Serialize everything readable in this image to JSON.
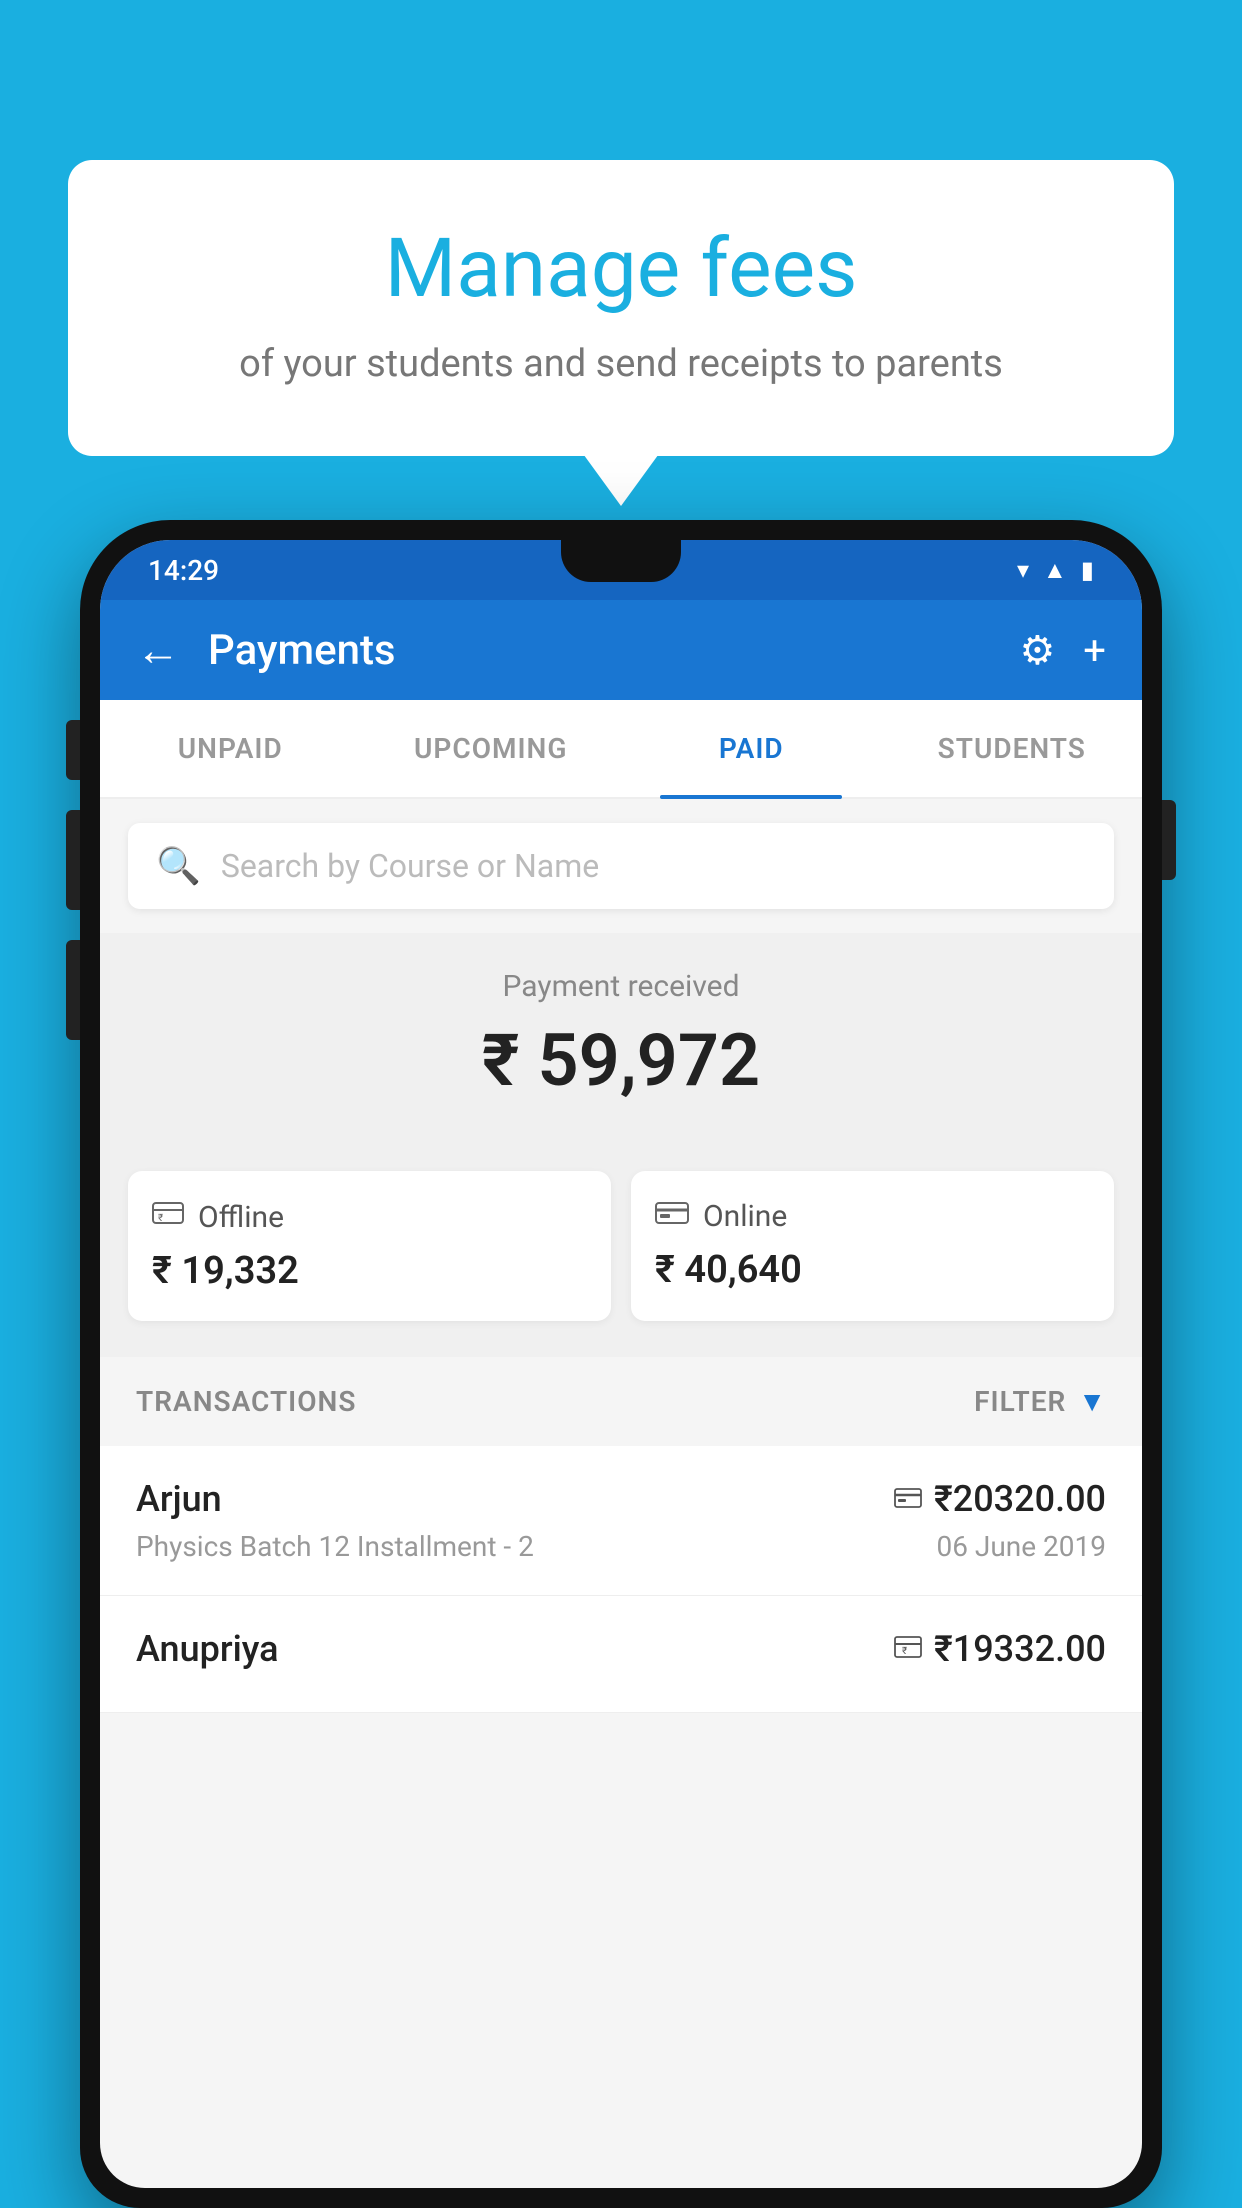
{
  "background_color": "#1AAFE0",
  "tooltip": {
    "title": "Manage fees",
    "subtitle": "of your students and send receipts to parents"
  },
  "phone": {
    "status_bar": {
      "time": "14:29",
      "icons": [
        "wifi",
        "signal",
        "battery"
      ]
    },
    "app_bar": {
      "title": "Payments",
      "back_icon": "←",
      "settings_icon": "⚙",
      "add_icon": "+"
    },
    "tabs": [
      {
        "label": "UNPAID",
        "active": false
      },
      {
        "label": "UPCOMING",
        "active": false
      },
      {
        "label": "PAID",
        "active": true
      },
      {
        "label": "STUDENTS",
        "active": false
      }
    ],
    "search": {
      "placeholder": "Search by Course or Name",
      "icon": "🔍"
    },
    "payment_received": {
      "label": "Payment received",
      "amount": "₹ 59,972"
    },
    "payment_cards": [
      {
        "type": "Offline",
        "icon": "💳",
        "amount": "₹ 19,332"
      },
      {
        "type": "Online",
        "icon": "💳",
        "amount": "₹ 40,640"
      }
    ],
    "transactions_label": "TRANSACTIONS",
    "filter_label": "FILTER",
    "transactions": [
      {
        "name": "Arjun",
        "description": "Physics Batch 12 Installment - 2",
        "amount": "₹20320.00",
        "date": "06 June 2019",
        "payment_type": "online"
      },
      {
        "name": "Anupriya",
        "description": "",
        "amount": "₹19332.00",
        "date": "",
        "payment_type": "offline"
      }
    ]
  }
}
